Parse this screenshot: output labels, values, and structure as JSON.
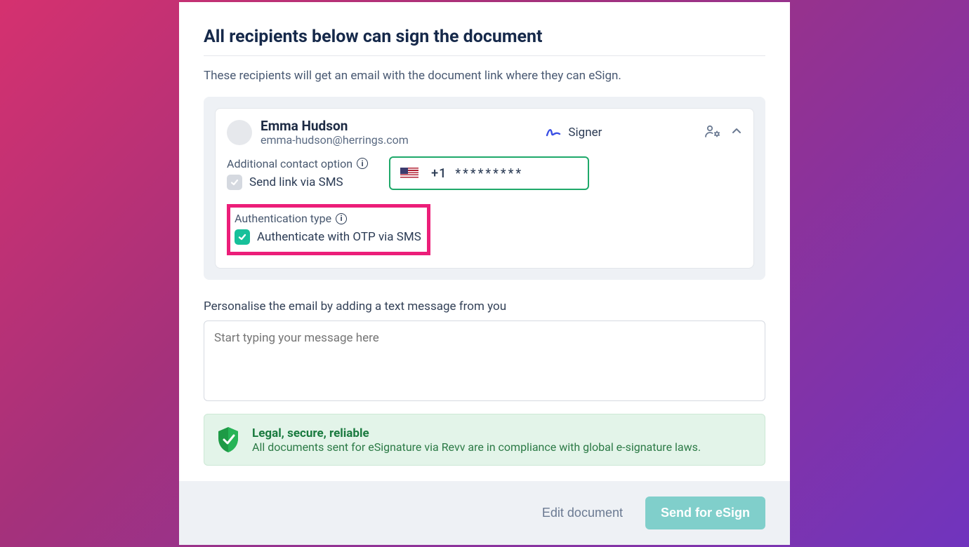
{
  "title": "All recipients below can sign the document",
  "description": "These recipients will get an email with the document link where they can eSign.",
  "recipient": {
    "name": "Emma Hudson",
    "email": "emma-hudson@herrings.com",
    "role": "Signer",
    "additional_contact_label": "Additional contact option",
    "send_sms_label": "Send link via SMS",
    "send_sms_checked": false,
    "phone_code": "+1",
    "phone_mask": "*********",
    "auth_label": "Authentication type",
    "auth_otp_label": "Authenticate with OTP via SMS",
    "auth_otp_checked": true
  },
  "personalise_label": "Personalise the email by adding a text message from you",
  "message_placeholder": "Start typing your message here",
  "legal": {
    "title": "Legal, secure, reliable",
    "text": "All documents sent for eSignature via Revv are in compliance with global e-signature laws."
  },
  "footer": {
    "edit_label": "Edit document",
    "send_label": "Send for eSign"
  },
  "colors": {
    "accent_teal": "#17c09a",
    "accent_green_border": "#1fa96a",
    "highlight_pink": "#ec1e79",
    "primary_button": "#80cfcb"
  }
}
